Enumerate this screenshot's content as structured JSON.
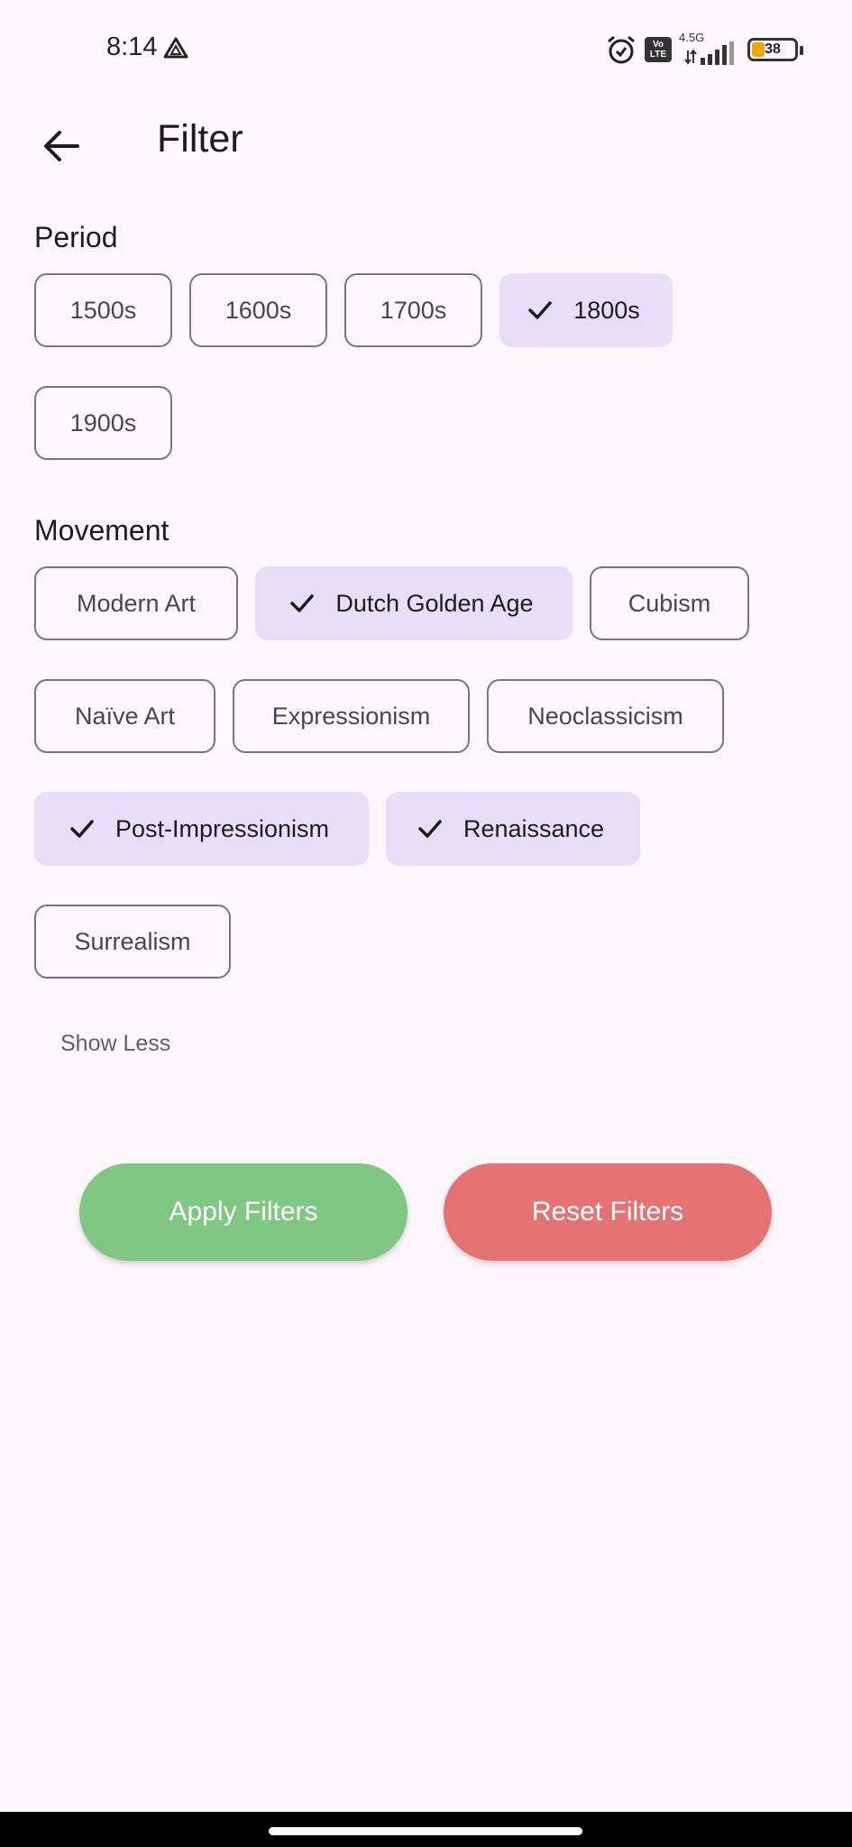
{
  "status_bar": {
    "time": "8:14",
    "network_type": "4.5G",
    "volte": "Vo\nLTE",
    "battery_level": "38",
    "icons": [
      "drive-icon",
      "alarm-icon",
      "volte-icon",
      "signal-icon",
      "battery-icon"
    ]
  },
  "app_bar": {
    "title": "Filter",
    "back_icon": "arrow-left-icon"
  },
  "period": {
    "heading": "Period",
    "chips": [
      {
        "label": "1500s",
        "selected": false
      },
      {
        "label": "1600s",
        "selected": false
      },
      {
        "label": "1700s",
        "selected": false
      },
      {
        "label": "1800s",
        "selected": true
      },
      {
        "label": "1900s",
        "selected": false
      }
    ]
  },
  "movement": {
    "heading": "Movement",
    "chips": [
      {
        "label": "Modern Art",
        "selected": false
      },
      {
        "label": "Dutch Golden Age",
        "selected": true
      },
      {
        "label": "Cubism",
        "selected": false
      },
      {
        "label": "Naïve Art",
        "selected": false
      },
      {
        "label": "Expressionism",
        "selected": false
      },
      {
        "label": "Neoclassicism",
        "selected": false
      },
      {
        "label": "Post-Impressionism",
        "selected": true
      },
      {
        "label": "Renaissance",
        "selected": true
      },
      {
        "label": "Surrealism",
        "selected": false
      }
    ],
    "toggle_label": "Show Less"
  },
  "actions": {
    "apply_label": "Apply Filters",
    "reset_label": "Reset Filters"
  },
  "colors": {
    "background": "#fdf7fc",
    "chip_selected": "#e8def8",
    "chip_border": "#79747e",
    "apply": "#81c784",
    "reset": "#e57373"
  }
}
